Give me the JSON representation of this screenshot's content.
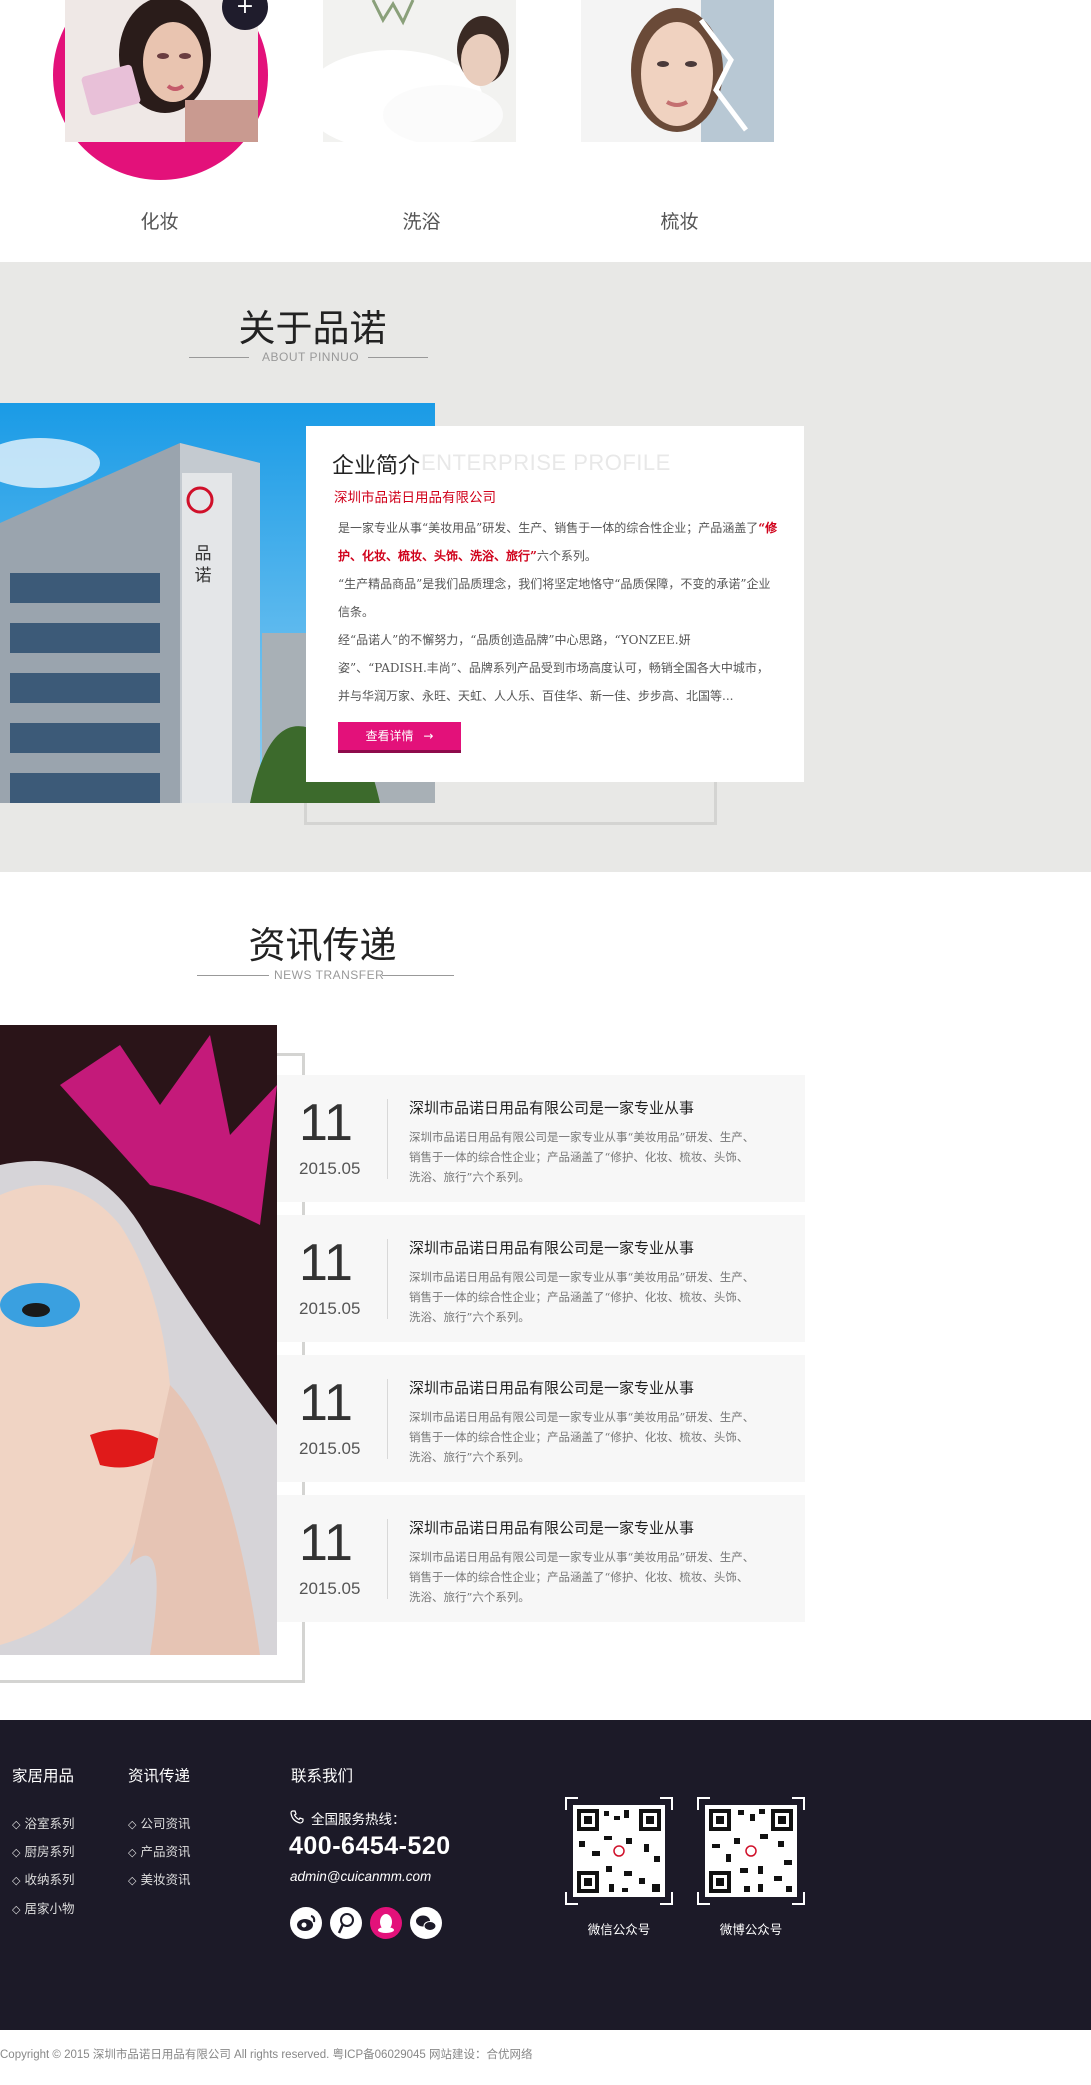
{
  "categories": [
    {
      "label": "化妆"
    },
    {
      "label": "洗浴"
    },
    {
      "label": "梳妆"
    }
  ],
  "category_button": "+",
  "about": {
    "title": "关于品诺",
    "subtitle": "ABOUT PINNUO",
    "card_title": "企业简介",
    "card_watermark": "ENTERPRISE PROFILE",
    "company": "深圳市品诺日用品有限公司",
    "p1_a": "是一家专业从事“美妆用品”研发、生产、销售于一体的综合性企业；产品涵盖了",
    "p1_red": "“修护、化妆、梳妆、头饰、洗浴、旅行”",
    "p1_b": "六个系列。",
    "p2": "“生产精品商品”是我们品质理念，我们将坚定地恪守“品质保障，不变的承诺”企业信条。",
    "p3": "经“品诺人”的不懈努力，“品质创造品牌”中心思路，“YONZEE.妍姿”、“PADISH.丰尚”、品牌系列产品受到市场高度认可，畅销全国各大中城市，并与华润万家、永旺、天虹、人人乐、百佳华、新一佳、步步高、北国等...",
    "button": "查看详情",
    "button_arrow": "→",
    "building_sign": "品诺"
  },
  "news": {
    "title": "资讯传递",
    "subtitle": "NEWS TRANSFER",
    "items": [
      {
        "day": "11",
        "date": "2015.05",
        "title": "深圳市品诺日用品有限公司是一家专业从事",
        "desc": "深圳市品诺日用品有限公司是一家专业从事“美妆用品”研发、生产、销售于一体的综合性企业；产品涵盖了“修护、化妆、梳妆、头饰、洗浴、旅行”六个系列。"
      },
      {
        "day": "11",
        "date": "2015.05",
        "title": "深圳市品诺日用品有限公司是一家专业从事",
        "desc": "深圳市品诺日用品有限公司是一家专业从事“美妆用品”研发、生产、销售于一体的综合性企业；产品涵盖了“修护、化妆、梳妆、头饰、洗浴、旅行”六个系列。"
      },
      {
        "day": "11",
        "date": "2015.05",
        "title": "深圳市品诺日用品有限公司是一家专业从事",
        "desc": "深圳市品诺日用品有限公司是一家专业从事“美妆用品”研发、生产、销售于一体的综合性企业；产品涵盖了“修护、化妆、梳妆、头饰、洗浴、旅行”六个系列。"
      },
      {
        "day": "11",
        "date": "2015.05",
        "title": "深圳市品诺日用品有限公司是一家专业从事",
        "desc": "深圳市品诺日用品有限公司是一家专业从事“美妆用品”研发、生产、销售于一体的综合性企业；产品涵盖了“修护、化妆、梳妆、头饰、洗浴、旅行”六个系列。"
      }
    ]
  },
  "footer": {
    "col1": {
      "head": "家居用品",
      "links": [
        "浴室系列",
        "厨房系列",
        "收纳系列",
        "居家小物"
      ]
    },
    "col2": {
      "head": "资讯传递",
      "links": [
        "公司资讯",
        "产品资讯",
        "美妆资讯"
      ]
    },
    "contact": {
      "head": "联系我们",
      "hotline_label": "全国服务热线：",
      "phone": "400-6454-520",
      "email": "admin@cuicanmm.com"
    },
    "social_icons": [
      "weibo-icon",
      "tencent-weibo-icon",
      "qq-icon",
      "wechat-icon"
    ],
    "qr": [
      {
        "label": "微信公众号"
      },
      {
        "label": "微博公众号"
      }
    ],
    "copyright": "Copyright © 2015  深圳市品诺日用品有限公司 All rights reserved.  粤ICP备06029045     网站建设：合优网络"
  },
  "colors": {
    "accent": "#e3117a",
    "footer_bg": "#1c1a28",
    "about_bg": "#e8e8e6",
    "red_text": "#d0021b"
  }
}
